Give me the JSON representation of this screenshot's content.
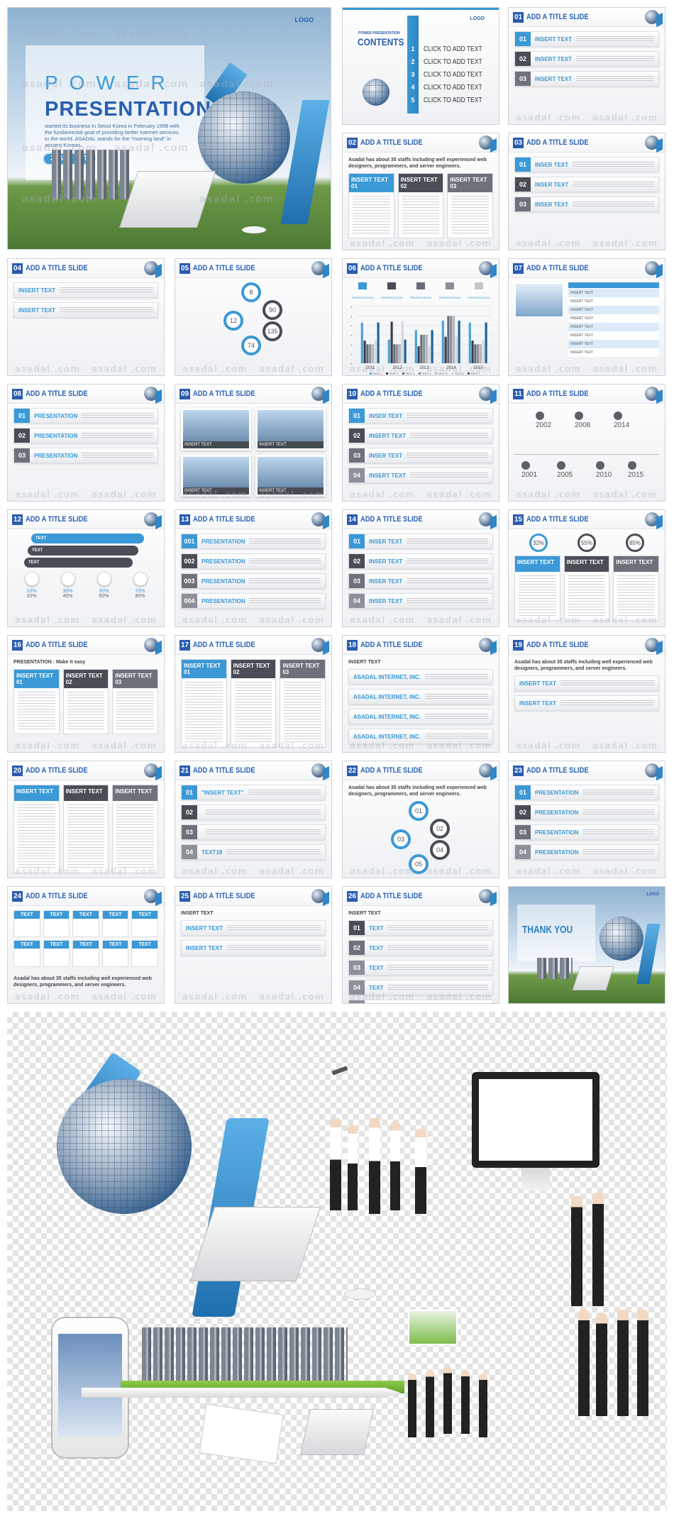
{
  "watermark": "asadal .com",
  "colors": {
    "accent": "#3a99d6",
    "brand_dark": "#2a5caf",
    "dark_gray": "#4a4d55"
  },
  "title_slide": {
    "logo": "LOGO",
    "heading_top": "POWER",
    "heading_main": "PRESENTATION",
    "description": "started its business in Seoul Korea in February 1998 with the fundamental goal of providing better internet services to the world. ASADAL stands for the \"morning land\" in ancient Korean.",
    "badge": "29SET PPT"
  },
  "contents_slide": {
    "logo": "LOGO",
    "subtitle": "POWER PRESENTATION",
    "title": "CONTENTS",
    "items": [
      {
        "num": "1",
        "label": "CLICK TO ADD TEXT"
      },
      {
        "num": "2",
        "label": "CLICK TO ADD TEXT"
      },
      {
        "num": "3",
        "label": "CLICK TO ADD TEXT"
      },
      {
        "num": "4",
        "label": "CLICK TO ADD TEXT"
      },
      {
        "num": "5",
        "label": "CLICK TO ADD TEXT"
      }
    ]
  },
  "slides": [
    {
      "num": "01",
      "title": "ADD A TITLE SLIDE",
      "layout": "rows",
      "items": [
        {
          "n": "01",
          "l": "INSERT TEXT"
        },
        {
          "n": "02",
          "l": "INSERT TEXT"
        },
        {
          "n": "03",
          "l": "INSERT TEXT"
        }
      ]
    },
    {
      "num": "02",
      "title": "ADD A TITLE SLIDE",
      "layout": "cols",
      "intro": "Asadal has about 35 staffs including well experienced web designers, programmers, and server engineers.",
      "items": [
        {
          "n": "01",
          "l": "INSERT TEXT"
        },
        {
          "n": "02",
          "l": "INSERT TEXT"
        },
        {
          "n": "03",
          "l": "INSERT TEXT"
        }
      ]
    },
    {
      "num": "03",
      "title": "ADD A TITLE SLIDE",
      "layout": "rows",
      "items": [
        {
          "n": "01",
          "l": "INSER TEXT"
        },
        {
          "n": "02",
          "l": "INSER TEXT"
        },
        {
          "n": "03",
          "l": "INSER TEXT"
        }
      ]
    },
    {
      "num": "04",
      "title": "ADD A TITLE SLIDE",
      "layout": "rows",
      "items": [
        {
          "n": "",
          "l": "INSERT TEXT"
        },
        {
          "n": "",
          "l": "INSERT TEXT"
        }
      ]
    },
    {
      "num": "05",
      "title": "ADD A TITLE SLIDE",
      "layout": "circles",
      "items": [
        {
          "l": "8"
        },
        {
          "l": "90"
        },
        {
          "l": "12"
        },
        {
          "l": "135"
        },
        {
          "l": "74"
        }
      ]
    },
    {
      "num": "06",
      "title": "ADD A TITLE SLIDE",
      "layout": "chart",
      "items": [
        {
          "l": "PRESENTATION"
        },
        {
          "l": "PRESENTATION"
        },
        {
          "l": "PRESENTATION"
        },
        {
          "l": "PRESENTATION"
        },
        {
          "l": "PRESENTATION"
        }
      ]
    },
    {
      "num": "07",
      "title": "ADD A TITLE SLIDE",
      "layout": "table",
      "items": [
        {
          "l": "INSERT TEXT"
        },
        {
          "l": "INSERT TEXT"
        },
        {
          "l": "INSERT TEXT"
        },
        {
          "l": "INSERT TEXT"
        },
        {
          "l": "INSERT TEXT"
        },
        {
          "l": "INSERT TEXT"
        },
        {
          "l": "INSERT TEXT"
        },
        {
          "l": "INSERT TEXT"
        }
      ]
    },
    {
      "num": "08",
      "title": "ADD A TITLE SLIDE",
      "layout": "rows",
      "items": [
        {
          "n": "01",
          "l": "PRESENTATION"
        },
        {
          "n": "02",
          "l": "PRESENTATION"
        },
        {
          "n": "03",
          "l": "PRESENTATION"
        }
      ]
    },
    {
      "num": "09",
      "title": "ADD A TITLE SLIDE",
      "layout": "grid",
      "items": [
        {
          "l": "INSERT TEXT"
        },
        {
          "l": "INSERT TEXT"
        },
        {
          "l": "INSERT TEXT"
        },
        {
          "l": "INSERT TEXT"
        }
      ]
    },
    {
      "num": "10",
      "title": "ADD A TITLE SLIDE",
      "layout": "rows",
      "items": [
        {
          "n": "01",
          "l": "INSER TEXT"
        },
        {
          "n": "02",
          "l": "INSERT TEXT"
        },
        {
          "n": "03",
          "l": "INSER TEXT"
        },
        {
          "n": "04",
          "l": "INSERT TEXT"
        }
      ]
    },
    {
      "num": "11",
      "title": "ADD A TITLE SLIDE",
      "layout": "timeline",
      "items": [
        {
          "l": "2002"
        },
        {
          "l": "2008"
        },
        {
          "l": "2014"
        },
        {
          "l": "2001"
        },
        {
          "l": "2005"
        },
        {
          "l": "2010"
        },
        {
          "l": "2015"
        }
      ]
    },
    {
      "num": "12",
      "title": "ADD A TITLE SLIDE",
      "layout": "percents",
      "items": [
        {
          "l": "TEXT"
        },
        {
          "l": "TEXT"
        },
        {
          "l": "TEXT"
        }
      ],
      "percents": [
        "10%",
        "30%",
        "50%",
        "70%",
        "20%",
        "40%",
        "60%",
        "80%"
      ]
    },
    {
      "num": "13",
      "title": "ADD A TITLE SLIDE",
      "layout": "rows",
      "items": [
        {
          "n": "001",
          "l": "PRESENTATION"
        },
        {
          "n": "002",
          "l": "PRESENTATION"
        },
        {
          "n": "003",
          "l": "PRESENTATION"
        },
        {
          "n": "004",
          "l": "PRESENTATION"
        }
      ]
    },
    {
      "num": "14",
      "title": "ADD A TITLE SLIDE",
      "layout": "rows",
      "items": [
        {
          "n": "01",
          "l": "INSER TEXT"
        },
        {
          "n": "02",
          "l": "INSER TEXT"
        },
        {
          "n": "03",
          "l": "INSER TEXT"
        },
        {
          "n": "04",
          "l": "INSER TEXT"
        }
      ]
    },
    {
      "num": "15",
      "title": "ADD A TITLE SLIDE",
      "layout": "cols",
      "circles": [
        "32%",
        "55%",
        "85%"
      ],
      "items": [
        {
          "n": "",
          "l": "INSERT TEXT"
        },
        {
          "n": "",
          "l": "INSERT TEXT"
        },
        {
          "n": "",
          "l": "INSERT TEXT"
        }
      ]
    },
    {
      "num": "16",
      "title": "ADD A TITLE SLIDE",
      "layout": "cols",
      "intro": "PRESENTATION : Make it easy",
      "items": [
        {
          "n": "01",
          "l": "INSERT TEXT"
        },
        {
          "n": "02",
          "l": "INSERT TEXT"
        },
        {
          "n": "03",
          "l": "INSERT TEXT"
        }
      ]
    },
    {
      "num": "17",
      "title": "ADD A TITLE SLIDE",
      "layout": "cols",
      "items": [
        {
          "n": "01",
          "l": "INSERT TEXT"
        },
        {
          "n": "02",
          "l": "INSERT TEXT"
        },
        {
          "n": "03",
          "l": "INSERT TEXT"
        }
      ]
    },
    {
      "num": "18",
      "title": "ADD A TITLE SLIDE",
      "layout": "rows",
      "intro": "INSERT TEXT",
      "items": [
        {
          "n": "",
          "l": "ASADAL INTERNET, INC."
        },
        {
          "n": "",
          "l": "ASADAL INTERNET, INC."
        },
        {
          "n": "",
          "l": "ASADAL INTERNET, INC."
        },
        {
          "n": "",
          "l": "ASADAL INTERNET, INC."
        }
      ]
    },
    {
      "num": "19",
      "title": "ADD A TITLE SLIDE",
      "layout": "rows",
      "intro": "Asadal has about 35 staffs including well experienced web designers, programmers, and server engineers.",
      "items": [
        {
          "n": "",
          "l": "INSERT TEXT"
        },
        {
          "n": "",
          "l": "INSERT TEXT"
        }
      ]
    },
    {
      "num": "20",
      "title": "ADD A TITLE SLIDE",
      "layout": "cols",
      "items": [
        {
          "n": "",
          "l": "INSERT TEXT"
        },
        {
          "n": "",
          "l": "INSERT TEXT"
        },
        {
          "n": "",
          "l": "INSERT TEXT"
        }
      ]
    },
    {
      "num": "21",
      "title": "ADD A TITLE SLIDE",
      "layout": "rows",
      "items": [
        {
          "n": "01",
          "l": "\"INSERT TEXT\""
        },
        {
          "n": "02",
          "l": ""
        },
        {
          "n": "03",
          "l": ""
        },
        {
          "n": "04",
          "l": "TEXT18"
        }
      ]
    },
    {
      "num": "22",
      "title": "ADD A TITLE SLIDE",
      "layout": "circles",
      "intro": "Asadal has about 35 staffs including well experienced web designers, programmers, and server engineers.",
      "items": [
        {
          "l": "01"
        },
        {
          "l": "02"
        },
        {
          "l": "03"
        },
        {
          "l": "04"
        },
        {
          "l": "05"
        }
      ]
    },
    {
      "num": "23",
      "title": "ADD A TITLE SLIDE",
      "layout": "rows",
      "items": [
        {
          "n": "01",
          "l": "PRESENTATION"
        },
        {
          "n": "02",
          "l": "PRESENTATION"
        },
        {
          "n": "03",
          "l": "PRESENTATION"
        },
        {
          "n": "04",
          "l": "PRESENTATION"
        }
      ]
    },
    {
      "num": "24",
      "title": "ADD A TITLE SLIDE",
      "layout": "grid10",
      "intro": "Asadal has about 35 staffs including well experienced web designers, programmers, and server engineers.",
      "items": [
        {
          "l": "TEXT"
        },
        {
          "l": "TEXT"
        },
        {
          "l": "TEXT"
        },
        {
          "l": "TEXT"
        },
        {
          "l": "TEXT"
        },
        {
          "l": "TEXT"
        },
        {
          "l": "TEXT"
        },
        {
          "l": "TEXT"
        },
        {
          "l": "TEXT"
        },
        {
          "l": "TEXT"
        }
      ]
    },
    {
      "num": "25",
      "title": "ADD A TITLE SLIDE",
      "layout": "rows",
      "intro": "INSERT TEXT",
      "items": [
        {
          "n": "",
          "l": "INSERT TEXT"
        },
        {
          "n": "",
          "l": "INSERT TEXT"
        }
      ]
    },
    {
      "num": "26",
      "title": "ADD A TITLE SLIDE",
      "layout": "rows",
      "intro": "INSERT TEXT",
      "items": [
        {
          "n": "01",
          "l": "TEXT"
        },
        {
          "n": "02",
          "l": "TEXT"
        },
        {
          "n": "03",
          "l": "TEXT"
        },
        {
          "n": "04",
          "l": "TEXT"
        },
        {
          "n": "05",
          "l": "TEXT"
        },
        {
          "n": "06",
          "l": "TEXT"
        }
      ]
    }
  ],
  "thank_you_slide": {
    "title": "THANK YOU",
    "logo": "LOGO"
  },
  "chart_data": {
    "type": "bar",
    "categories": [
      "2011",
      "2012",
      "2013",
      "2014",
      "2015"
    ],
    "ylim": [
      0,
      6
    ],
    "yticks": [
      "0",
      "1",
      "2",
      "3",
      "4",
      "5",
      "6"
    ],
    "grid": true,
    "legend_position": "bottom",
    "series": [
      {
        "name": "TEXT 1",
        "color": "#4aa3d9",
        "values": [
          4.3,
          2.5,
          3.5,
          4.5,
          4.3
        ]
      },
      {
        "name": "TEXT 2",
        "color": "#3d3f47",
        "values": [
          2.4,
          4.4,
          1.8,
          2.8,
          2.4
        ]
      },
      {
        "name": "TEXT 3",
        "color": "#676c76",
        "values": [
          2.0,
          2.0,
          3.0,
          5.0,
          2.0
        ]
      },
      {
        "name": "TEXT 4",
        "color": "#8a8f99",
        "values": [
          2.0,
          2.0,
          3.0,
          5.0,
          2.0
        ]
      },
      {
        "name": "TEXT 5",
        "color": "#b4b8bf",
        "values": [
          2.0,
          2.0,
          3.0,
          5.0,
          2.0
        ]
      },
      {
        "name": "TEXT 6",
        "color": "#d6d8dc",
        "values": [
          2.4,
          4.4,
          1.8,
          2.8,
          2.4
        ]
      },
      {
        "name": "TEXT 7",
        "color": "#1f6396",
        "values": [
          4.3,
          2.5,
          3.5,
          4.5,
          4.3
        ]
      }
    ]
  }
}
